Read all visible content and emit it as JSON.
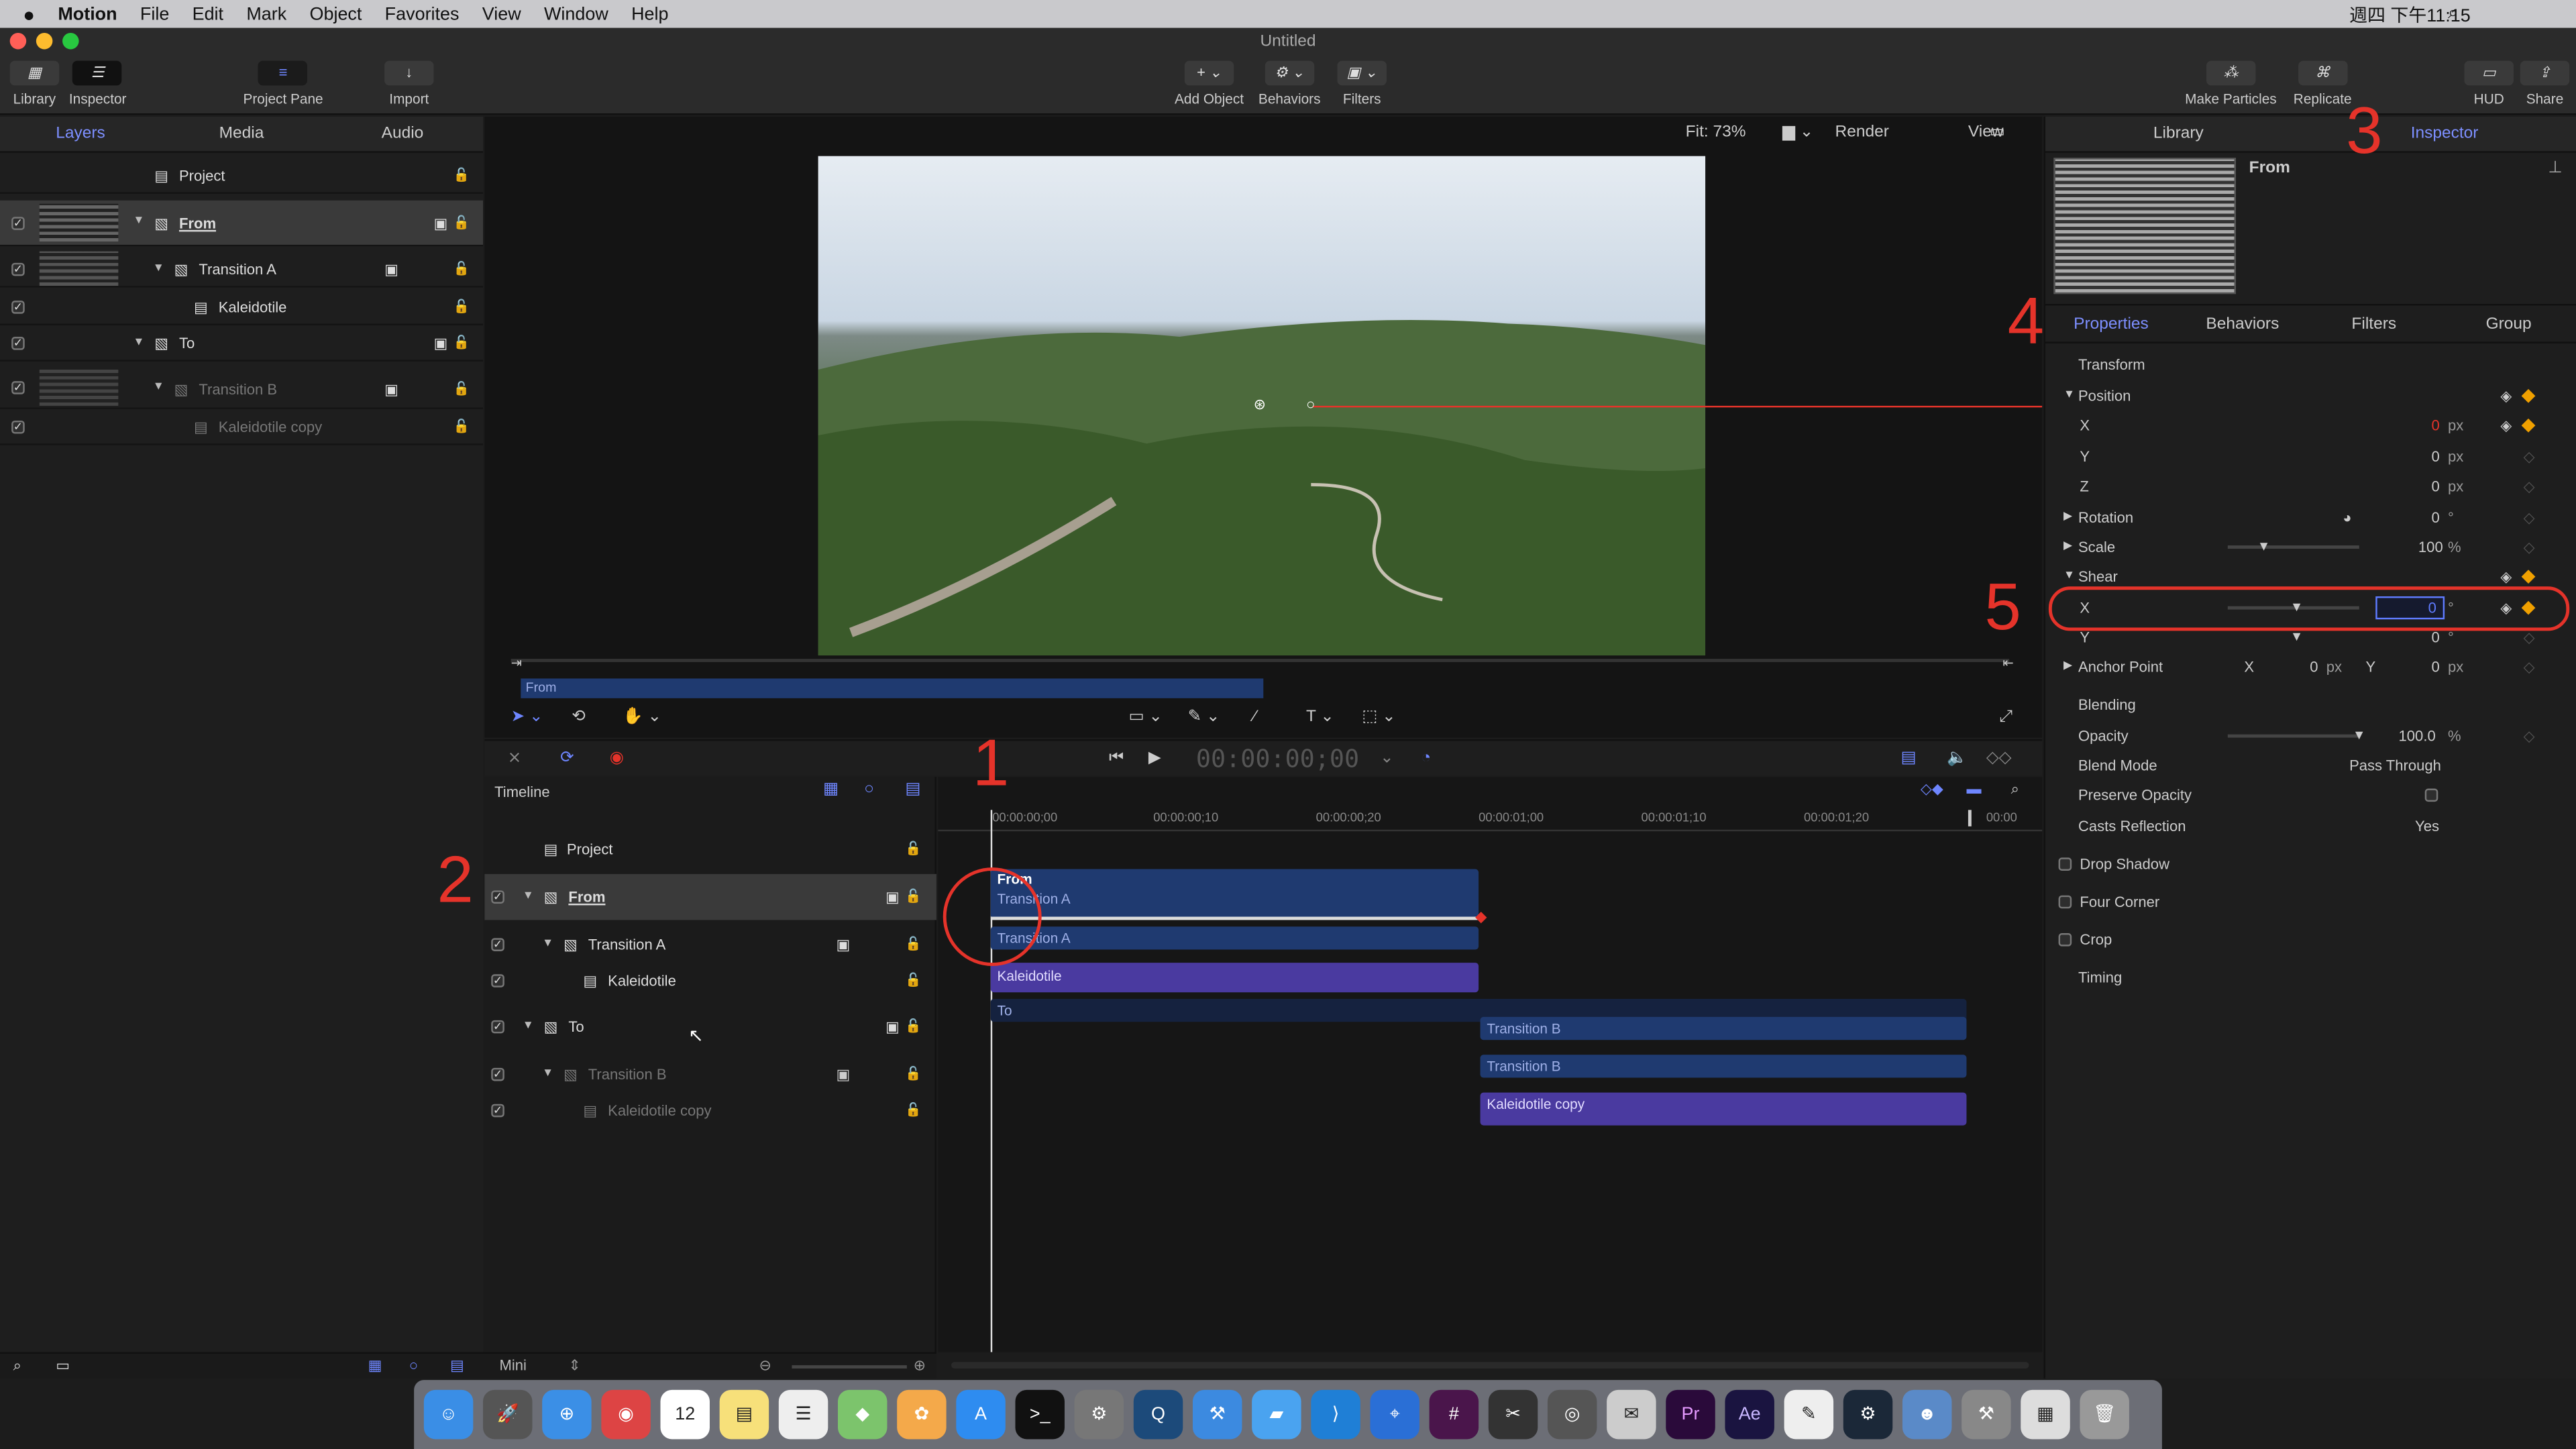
{
  "menubar": {
    "app": "Motion",
    "items": [
      "File",
      "Edit",
      "Mark",
      "Object",
      "Favorites",
      "View",
      "Window",
      "Help"
    ],
    "clock": "週四 下午11:15"
  },
  "window": {
    "title": "Untitled"
  },
  "toolbar": {
    "library": "Library",
    "inspector": "Inspector",
    "project_pane": "Project Pane",
    "import": "Import",
    "add_object": "Add Object",
    "behaviors": "Behaviors",
    "filters": "Filters",
    "make_particles": "Make Particles",
    "replicate": "Replicate",
    "hud": "HUD",
    "share": "Share"
  },
  "left_tabs": [
    "Layers",
    "Media",
    "Audio"
  ],
  "layers": [
    {
      "name": "Project"
    },
    {
      "name": "From"
    },
    {
      "name": "Transition A"
    },
    {
      "name": "Kaleidotile"
    },
    {
      "name": "To"
    },
    {
      "name": "Transition B"
    },
    {
      "name": "Kaleidotile copy"
    }
  ],
  "canvas": {
    "fit": "Fit: 73%",
    "render": "Render",
    "view": "View",
    "mini_bar": "From"
  },
  "transport": {
    "timecode": "00:00:00;00"
  },
  "timeline": {
    "label": "Timeline",
    "ruler": [
      "00:00:00;00",
      "00:00:00;10",
      "00:00:00;20",
      "00:00:01;00",
      "00:00:01;10",
      "00:00:01;20",
      "00:00"
    ],
    "bars": [
      "From",
      "Transition A",
      "Transition A",
      "Kaleidotile",
      "To",
      "Transition B",
      "Transition B",
      "Kaleidotile copy"
    ],
    "mini": "Mini"
  },
  "inspector": {
    "tabs_top": [
      "Library",
      "Inspector"
    ],
    "object": "From",
    "tabs": [
      "Properties",
      "Behaviors",
      "Filters",
      "Group"
    ],
    "transform": "Transform",
    "position": "Position",
    "x": "X",
    "y": "Y",
    "z": "Z",
    "px": "px",
    "deg": "°",
    "pct": "%",
    "pos_x": "0",
    "pos_y": "0",
    "pos_z": "0",
    "rotation": "Rotation",
    "rotation_val": "0",
    "scale": "Scale",
    "scale_val": "100",
    "shear": "Shear",
    "shear_x": "0",
    "shear_y": "0",
    "anchor": "Anchor Point",
    "anchor_x": "0",
    "anchor_y": "0",
    "blending": "Blending",
    "opacity": "Opacity",
    "opacity_val": "100.0",
    "blend_mode": "Blend Mode",
    "blend_val": "Pass Through",
    "preserve": "Preserve Opacity",
    "casts": "Casts Reflection",
    "casts_val": "Yes",
    "drop_shadow": "Drop Shadow",
    "four_corner": "Four Corner",
    "crop": "Crop",
    "timing": "Timing"
  },
  "annotations": [
    "1",
    "2",
    "3",
    "4",
    "5"
  ],
  "colors": {
    "accent": "#5f7bff",
    "annotation": "#e5332a",
    "clip_blue": "#1f3a70",
    "clip_purple": "#4a3aa0"
  }
}
